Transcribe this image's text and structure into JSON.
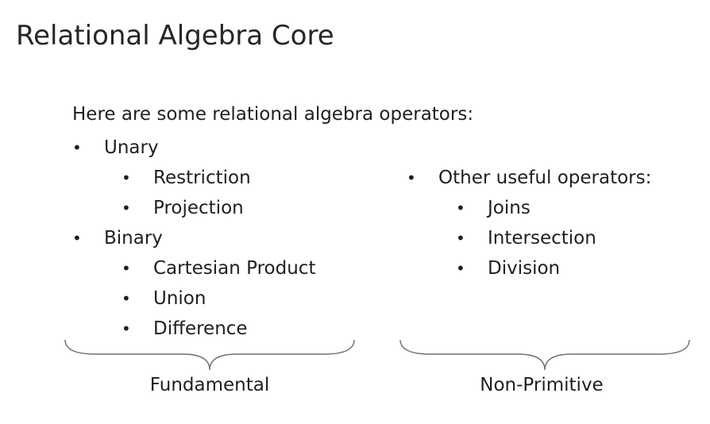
{
  "slide": {
    "title": "Relational Algebra Core",
    "intro": "Here are some relational algebra operators:",
    "bullet_glyph": "•"
  },
  "left_column": {
    "items": [
      {
        "label": "Unary",
        "children": [
          "Restriction",
          "Projection"
        ]
      },
      {
        "label": "Binary",
        "children": [
          "Cartesian Product",
          "Union",
          "Difference"
        ]
      }
    ],
    "group_label": "Fundamental"
  },
  "right_column": {
    "items": [
      {
        "label": "Other useful operators:",
        "children": [
          "Joins",
          "Intersection",
          "Division"
        ]
      }
    ],
    "group_label": "Non-Primitive"
  },
  "colors": {
    "text": "#1f1f1f",
    "brace": "#6e6e6e"
  }
}
